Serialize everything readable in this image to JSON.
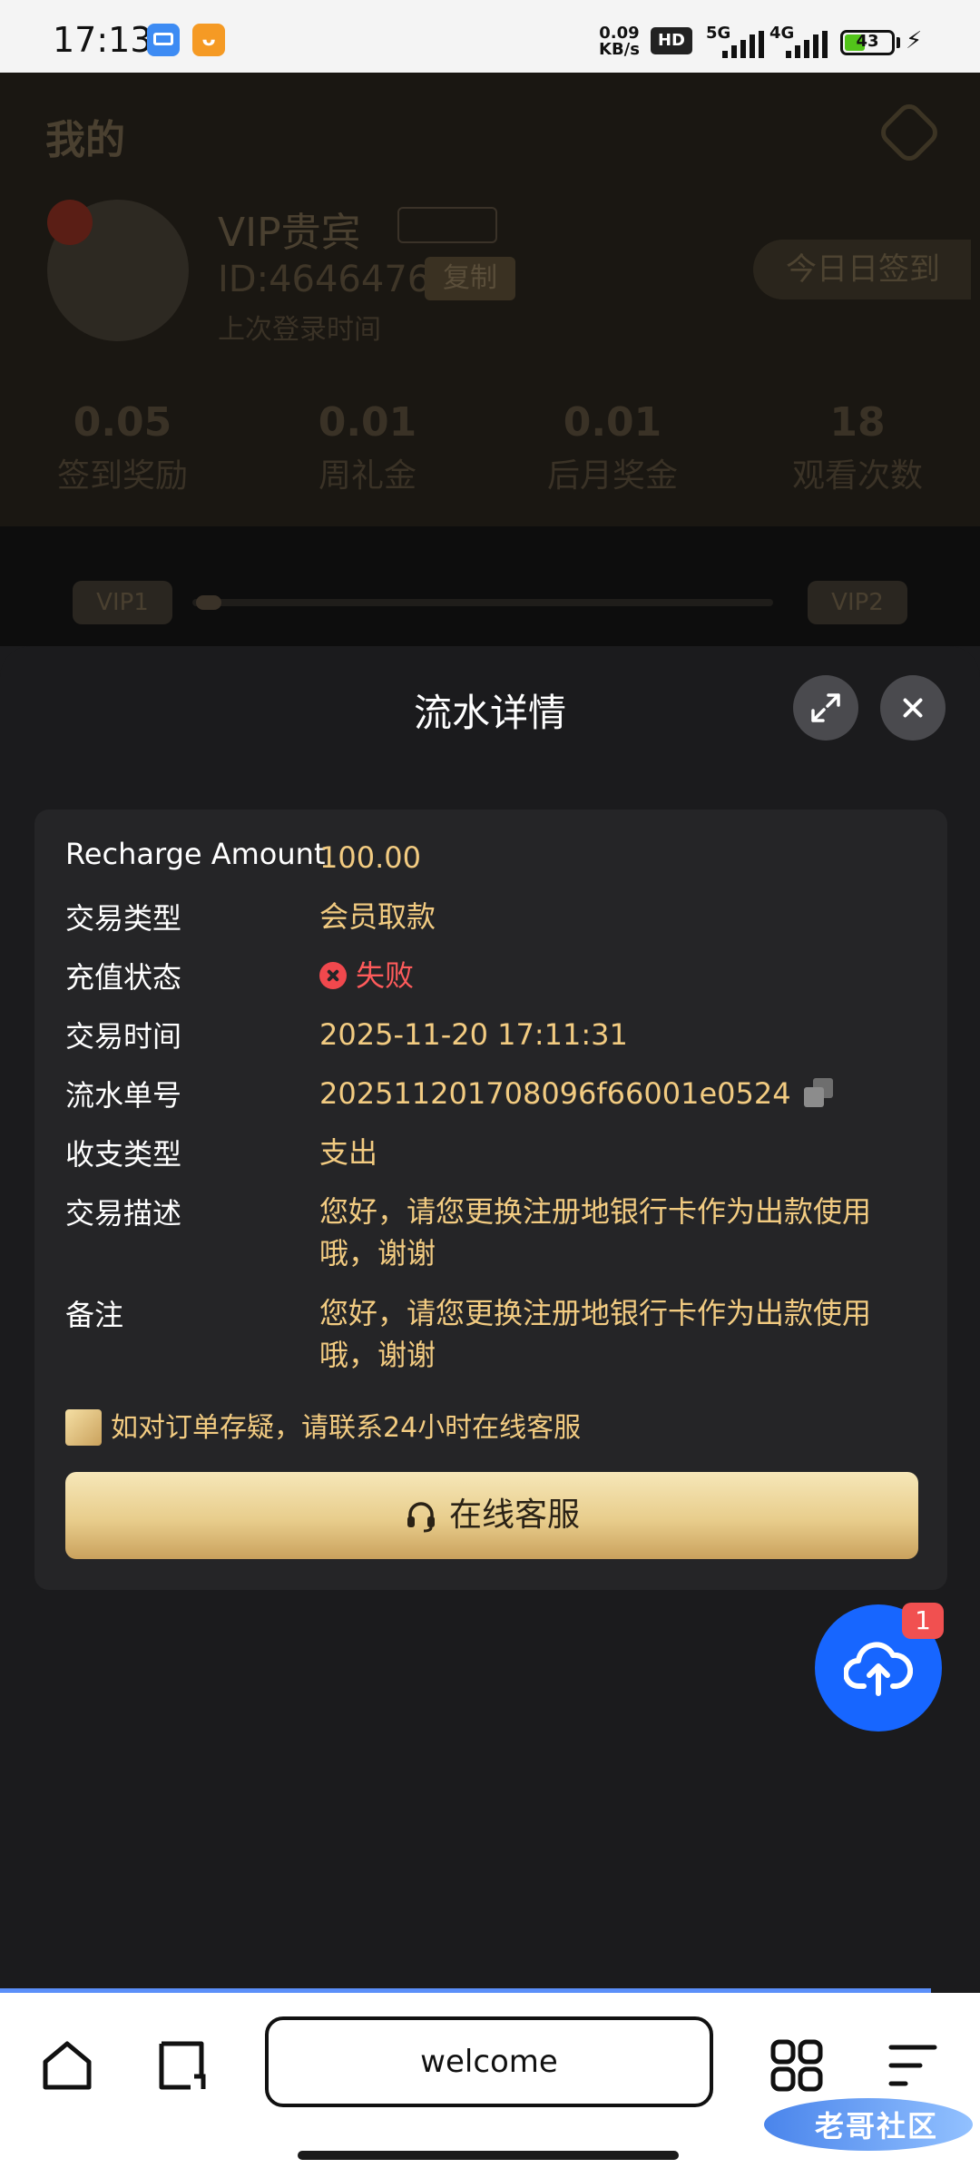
{
  "status_bar": {
    "time": "17:13",
    "speed_value": "0.09",
    "speed_unit": "KB/s",
    "hd_label": "HD",
    "net1": "5G",
    "net2": "4G",
    "battery": "43"
  },
  "background": {
    "title": "我的",
    "vip_name": "VIP贵宾",
    "user_id": "ID:4646476",
    "copy_label": "复制",
    "sub_text": "上次登录时间",
    "sign_in": "今日日签到",
    "stats": [
      {
        "value": "0.05",
        "label": "签到奖励"
      },
      {
        "value": "0.01",
        "label": "周礼金"
      },
      {
        "value": "0.01",
        "label": "后月奖金"
      },
      {
        "value": "18",
        "label": "观看次数"
      }
    ],
    "vip_left": "VIP1",
    "vip_right": "VIP2"
  },
  "sheet": {
    "title": "流水详情",
    "rows": [
      {
        "key": "Recharge Amount",
        "value": "100.00"
      },
      {
        "key": "交易类型",
        "value": "会员取款"
      },
      {
        "key": "充值状态",
        "value": "失败"
      },
      {
        "key": "交易时间",
        "value": "2025-11-20 17:11:31"
      },
      {
        "key": "流水单号",
        "value": "202511201708096f66001e0524"
      },
      {
        "key": "收支类型",
        "value": "支出"
      },
      {
        "key": "交易描述",
        "value": "您好，请您更换注册地银行卡作为出款使用哦，谢谢"
      },
      {
        "key": "备注",
        "value": "您好，请您更换注册地银行卡作为出款使用哦，谢谢"
      }
    ],
    "tip": "如对订单存疑，请联系24小时在线客服",
    "service_button": "在线客服"
  },
  "floating": {
    "badge": "1"
  },
  "browser": {
    "url_text": "welcome"
  },
  "watermark": {
    "text": "老哥社区"
  },
  "colors": {
    "accent_gold": "#f2cb81",
    "fail_red": "#ff5b5b",
    "float_blue": "#1766ff"
  }
}
